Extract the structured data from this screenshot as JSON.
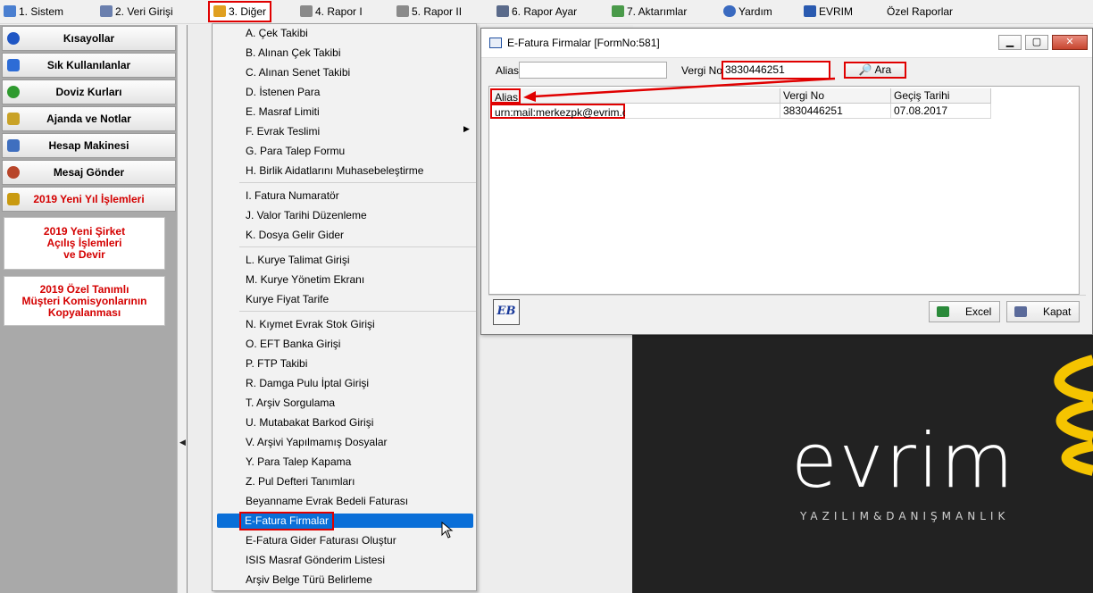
{
  "menubar": {
    "items": [
      {
        "label": "1.  Sistem",
        "icon": "system-icon"
      },
      {
        "label": "2.  Veri Girişi",
        "icon": "edit-icon"
      },
      {
        "label": "3.  Diğer",
        "icon": "other-icon"
      },
      {
        "label": "4.  Rapor I",
        "icon": "printer-icon"
      },
      {
        "label": "5.  Rapor II",
        "icon": "printer-icon"
      },
      {
        "label": "6.  Rapor Ayar",
        "icon": "report-settings-icon"
      },
      {
        "label": "7.  Aktarımlar",
        "icon": "transfer-icon"
      },
      {
        "label": "Yardım",
        "icon": "help-icon"
      },
      {
        "label": "EVRIM",
        "icon": "evrim-icon"
      },
      {
        "label": "Özel Raporlar",
        "icon": ""
      }
    ]
  },
  "sidebar": {
    "buttons": [
      {
        "label": "Kısayollar",
        "icon": "shortcut-icon",
        "color": "#1f56c4"
      },
      {
        "label": "Sık Kullanılanlar",
        "icon": "favorites-icon",
        "color": "#2d6cd6"
      },
      {
        "label": "Doviz Kurları",
        "icon": "currency-icon",
        "color": "#2f9a2f"
      },
      {
        "label": "Ajanda ve Notlar",
        "icon": "agenda-icon",
        "color": "#c9a227"
      },
      {
        "label": "Hesap Makinesi",
        "icon": "calculator-icon",
        "color": "#3f6fbf"
      },
      {
        "label": "Mesaj Gönder",
        "icon": "message-icon",
        "color": "#b8452a"
      },
      {
        "label": "2019 Yeni Yıl İşlemleri",
        "icon": "scale-icon",
        "color": "#c99a10"
      }
    ],
    "cards": [
      "2019 Yeni Şirket\nAçılış İşlemleri\nve Devir",
      "2019 Özel Tanımlı\nMüşteri Komisyonlarının\nKopyalanması"
    ]
  },
  "dropdown": {
    "items": [
      "A.  Çek Takibi",
      "B.  Alınan Çek Takibi",
      "C.  Alınan Senet Takibi",
      "D.  İstenen Para",
      "E.  Masraf Limiti",
      "F.  Evrak Teslimi",
      "G.  Para Talep Formu",
      "H.  Birlik Aidatlarını Muhasebeleştirme",
      "I.  Fatura Numaratör",
      "J.  Valor Tarihi Düzenleme",
      "K.  Dosya Gelir Gider",
      "L.  Kurye Talimat Girişi",
      "M.  Kurye Yönetim Ekranı",
      "Kurye Fiyat Tarife",
      "N.  Kıymet Evrak Stok Girişi",
      "O.  EFT Banka Girişi",
      "P.  FTP Takibi",
      "R.  Damga Pulu İptal  Girişi",
      "T. Arşiv Sorgulama",
      "U. Mutabakat Barkod Girişi",
      "V. Arşivi Yapılmamış Dosyalar",
      "Y.  Para Talep Kapama",
      "Z. Pul Defteri Tanımları",
      "Beyanname Evrak Bedeli Faturası",
      "E-Fatura Firmalar",
      "E-Fatura Gider Faturası Oluştur",
      "ISIS Masraf Gönderim Listesi",
      "Arşiv Belge Türü Belirleme"
    ],
    "selected_index": 24
  },
  "dialog": {
    "title": "E-Fatura Firmalar [FormNo:581]",
    "alias_label": "Alias",
    "alias_value": "",
    "vergi_label": "Vergi No",
    "vergi_value": "3830446251",
    "search_button": "Ara",
    "grid": {
      "columns": [
        "Alias",
        "Vergi No",
        "Geçiş Tarihi"
      ],
      "rows": [
        [
          "urn:mail:merkezpk@evrim.com",
          "3830446251",
          "07.08.2017"
        ]
      ]
    },
    "footer": {
      "logo": "EB",
      "excel_button": "Excel",
      "close_button": "Kapat"
    }
  },
  "brand": {
    "name": "evrim",
    "tagline": "YAZILIM&DANIŞMANLIK"
  },
  "colors": {
    "highlight": "#0a6fd8",
    "annotation": "#e00000",
    "logo_bg": "#222222",
    "logo_accent": "#f5c400"
  }
}
